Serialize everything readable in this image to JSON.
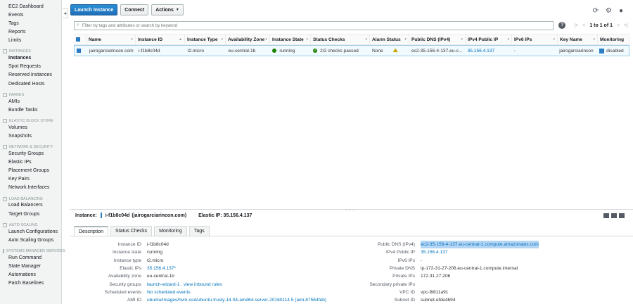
{
  "sidebar": {
    "items": [
      {
        "type": "item",
        "label": "EC2 Dashboard"
      },
      {
        "type": "item",
        "label": "Events"
      },
      {
        "type": "item",
        "label": "Tags"
      },
      {
        "type": "item",
        "label": "Reports"
      },
      {
        "type": "item",
        "label": "Limits"
      },
      {
        "type": "section",
        "label": "INSTANCES"
      },
      {
        "type": "item",
        "label": "Instances",
        "active": true
      },
      {
        "type": "item",
        "label": "Spot Requests"
      },
      {
        "type": "item",
        "label": "Reserved Instances"
      },
      {
        "type": "item",
        "label": "Dedicated Hosts"
      },
      {
        "type": "section",
        "label": "IMAGES"
      },
      {
        "type": "item",
        "label": "AMIs"
      },
      {
        "type": "item",
        "label": "Bundle Tasks"
      },
      {
        "type": "section",
        "label": "ELASTIC BLOCK STORE"
      },
      {
        "type": "item",
        "label": "Volumes"
      },
      {
        "type": "item",
        "label": "Snapshots"
      },
      {
        "type": "section",
        "label": "NETWORK & SECURITY"
      },
      {
        "type": "item",
        "label": "Security Groups"
      },
      {
        "type": "item",
        "label": "Elastic IPs"
      },
      {
        "type": "item",
        "label": "Placement Groups"
      },
      {
        "type": "item",
        "label": "Key Pairs"
      },
      {
        "type": "item",
        "label": "Network Interfaces"
      },
      {
        "type": "section",
        "label": "LOAD BALANCING"
      },
      {
        "type": "item",
        "label": "Load Balancers"
      },
      {
        "type": "item",
        "label": "Target Groups"
      },
      {
        "type": "section",
        "label": "AUTO SCALING"
      },
      {
        "type": "item",
        "label": "Launch Configurations"
      },
      {
        "type": "item",
        "label": "Auto Scaling Groups"
      },
      {
        "type": "section",
        "label": "SYSTEMS MANAGER SERVICES"
      },
      {
        "type": "item",
        "label": "Run Command"
      },
      {
        "type": "item",
        "label": "State Manager"
      },
      {
        "type": "item",
        "label": "Automations"
      },
      {
        "type": "item",
        "label": "Patch Baselines"
      }
    ]
  },
  "toolbar": {
    "launch_label": "Launch Instance",
    "connect_label": "Connect",
    "actions_label": "Actions"
  },
  "search": {
    "placeholder": "Filter by tags and attributes or search by keyword"
  },
  "pager": {
    "text": "1 to 1 of 1"
  },
  "table": {
    "columns": [
      {
        "key": "name",
        "label": "Name"
      },
      {
        "key": "id",
        "label": "Instance ID"
      },
      {
        "key": "type",
        "label": "Instance Type"
      },
      {
        "key": "az",
        "label": "Availability Zone"
      },
      {
        "key": "state",
        "label": "Instance State"
      },
      {
        "key": "checks",
        "label": "Status Checks"
      },
      {
        "key": "alarm",
        "label": "Alarm Status"
      },
      {
        "key": "dns",
        "label": "Public DNS (IPv4)"
      },
      {
        "key": "ipv4",
        "label": "IPv4 Public IP"
      },
      {
        "key": "ipv6",
        "label": "IPv6 IPs"
      },
      {
        "key": "key",
        "label": "Key Name"
      },
      {
        "key": "mon",
        "label": "Monitoring"
      }
    ],
    "rows": [
      {
        "name": "jairogarciarincon.com",
        "id": "i-f1b8c04d",
        "type": "t2.micro",
        "az": "eu-central-1b",
        "state": "running",
        "checks": "2/2 checks passed",
        "alarm": "None",
        "dns": "ec2-35-156-4-137.eu-c...",
        "ipv4": "35.156.4.137",
        "ipv6": "-",
        "key": "jairogarciarincon",
        "mon": "disabled"
      }
    ]
  },
  "detail": {
    "instance_label": "Instance:",
    "instance_id": "i-f1b8c04d",
    "instance_name": "(jairogarciarincon.com)",
    "elastic_label": "Elastic IP: 35.156.4.137",
    "tabs": [
      "Description",
      "Status Checks",
      "Monitoring",
      "Tags"
    ],
    "left": [
      {
        "label": "Instance ID",
        "value": "i-f1b8c04d"
      },
      {
        "label": "Instance state",
        "value": "running"
      },
      {
        "label": "Instance type",
        "value": "t2.micro"
      },
      {
        "label": "Elastic IPs",
        "value": "35.156.4.137*",
        "link": true
      },
      {
        "label": "Availability zone",
        "value": "eu-central-1b"
      },
      {
        "label": "Security groups",
        "value": "launch-wizard-1 . view inbound rules",
        "link": true
      },
      {
        "label": "Scheduled events",
        "value": "No scheduled events",
        "link": true
      },
      {
        "label": "AMI ID",
        "value": "ubuntu/images/hvm-ssd/ubuntu-trusty-14.04-amd64-server-20160114.5 (ami-87564feb)",
        "link": true
      }
    ],
    "right": [
      {
        "label": "Public DNS (IPv4)",
        "value": "ec2-35-156-4-137.eu-central-1.compute.amazonaws.com",
        "link": true,
        "highlight": true
      },
      {
        "label": "IPv4 Public IP",
        "value": "35.156.4.137",
        "link": true
      },
      {
        "label": "IPv6 IPs",
        "value": "-"
      },
      {
        "label": "Private DNS",
        "value": "ip-172-31-27-206.eu-central-1.compute.internal"
      },
      {
        "label": "Private IPs",
        "value": "172.31.27.206"
      },
      {
        "label": "Secondary private IPs",
        "value": ""
      },
      {
        "label": "VPC ID",
        "value": "vpc-f8811a91"
      },
      {
        "label": "Subnet ID",
        "value": "subnet-efde4b94"
      }
    ]
  },
  "colors": {
    "primary": "#1f6fb8",
    "link": "#0073bb",
    "running": "#1d8102",
    "selected_row": "#f1faff"
  }
}
